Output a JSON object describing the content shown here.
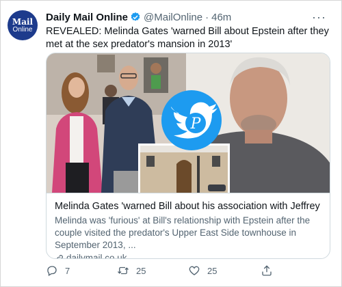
{
  "account": {
    "avatar_line1": "Mail",
    "avatar_line2": "Online",
    "display_name": "Daily Mail Online",
    "handle": "@MailOnline",
    "separator": "·",
    "time": "46m",
    "verified": true
  },
  "more_label": "···",
  "tweet": {
    "text": "REVEALED: Melinda Gates 'warned Bill about Epstein after they met at the sex predator's mansion in 2013'"
  },
  "card": {
    "title": "Melinda Gates 'warned Bill about his association with Jeffrey Epstein'",
    "description": "Melinda was 'furious' at Bill's relationship with Epstein after the couple visited the predator's Upper East Side townhouse in September 2013, ...",
    "domain": "dailymail.co.uk",
    "watermark_letter": "P"
  },
  "actions": {
    "reply_count": "7",
    "retweet_count": "25",
    "like_count": "25"
  },
  "colors": {
    "brand_blue": "#1d9bf0",
    "avatar_bg": "#1d3b8c",
    "muted_text": "#536471"
  }
}
